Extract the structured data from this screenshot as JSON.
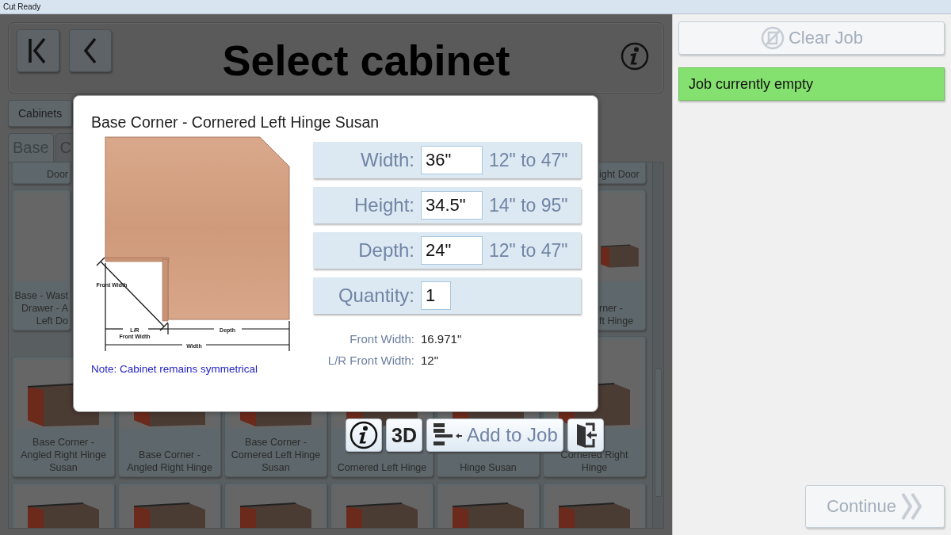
{
  "window": {
    "title": "Cut Ready"
  },
  "header": {
    "title": "Select cabinet"
  },
  "category_tabs": [
    {
      "label": "Cabinets",
      "selected": true
    }
  ],
  "type_tabs": [
    {
      "label": "Base",
      "selected": true
    },
    {
      "label": "C",
      "selected": false
    }
  ],
  "grid": {
    "rows": [
      {
        "kind": "caption",
        "cells": [
          {
            "kind": "tile",
            "label": "Door"
          },
          {
            "kind": "covered"
          },
          {
            "kind": "covered"
          },
          {
            "kind": "covered"
          },
          {
            "kind": "covered"
          },
          {
            "kind": "tile",
            "label": "ight Door"
          }
        ]
      },
      {
        "kind": "full",
        "cells": [
          {
            "kind": "tile",
            "label": "Base - Wast\nDrawer - A\nLeft Do"
          },
          {
            "kind": "covered"
          },
          {
            "kind": "covered"
          },
          {
            "kind": "covered"
          },
          {
            "kind": "covered"
          },
          {
            "kind": "tile",
            "label": "rner -\nft Hinge"
          }
        ]
      },
      {
        "kind": "full",
        "cells": [
          {
            "kind": "tile",
            "label": "Base Corner -\nAngled Right Hinge\nSusan"
          },
          {
            "kind": "tile",
            "label": "Base Corner -\nAngled Right Hinge"
          },
          {
            "kind": "tile",
            "label": "Base Corner -\nCornered Left Hinge\nSusan"
          },
          {
            "kind": "tile",
            "label": "Cornered Left Hinge"
          },
          {
            "kind": "tile",
            "label": "Hinge Susan"
          },
          {
            "kind": "tile",
            "label": "Cornered Right\nHinge"
          }
        ]
      },
      {
        "kind": "image",
        "cells": [
          {
            "kind": "tile"
          },
          {
            "kind": "tile"
          },
          {
            "kind": "tile"
          },
          {
            "kind": "tile"
          },
          {
            "kind": "tile"
          },
          {
            "kind": "tile"
          }
        ]
      }
    ]
  },
  "dialog": {
    "title": "Base Corner - Cornered Left Hinge Susan",
    "diagram_labels": [
      {
        "kind": "front",
        "text": "Front Width"
      },
      {
        "kind": "lr",
        "text": "L/R"
      },
      {
        "kind": "lr2",
        "text": "Front Width"
      },
      {
        "kind": "depth",
        "text": "Depth"
      },
      {
        "kind": "width",
        "text": "Width"
      }
    ],
    "note": "Note: Cabinet remains symmetrical",
    "fields": [
      {
        "label": "Width:",
        "value": "36\"",
        "range": "12\" to 47\""
      },
      {
        "label": "Height:",
        "value": "34.5\"",
        "range": "14\" to 95\""
      },
      {
        "label": "Depth:",
        "value": "24\"",
        "range": "12\" to 47\""
      },
      {
        "label": "Quantity:",
        "value": "1"
      }
    ],
    "info": [
      {
        "label": "Front Width:",
        "value": "16.971\""
      },
      {
        "label": "L/R Front Width:",
        "value": "12\""
      }
    ]
  },
  "actions": [
    {
      "kind": "info"
    },
    {
      "kind": "view",
      "label": "3D"
    },
    {
      "kind": "add",
      "label": "Add to Job"
    },
    {
      "kind": "exit"
    }
  ],
  "side": {
    "clear_job": {
      "label": "Clear Job",
      "disabled": true
    },
    "status": "Job currently empty",
    "continue": {
      "label": "Continue",
      "disabled": true
    }
  }
}
